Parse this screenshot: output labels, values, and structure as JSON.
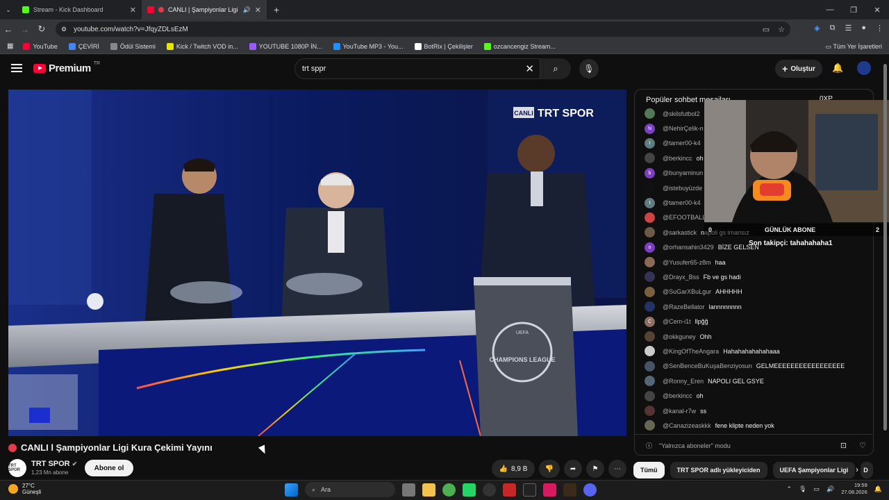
{
  "browser": {
    "tabs": [
      {
        "title": "Stream - Kick Dashboard",
        "color": "#53fc18",
        "active": false
      },
      {
        "title": "CANLI | Şampiyonlar Ligi",
        "color": "#ff0033",
        "active": true
      }
    ],
    "url": "youtube.com/watch?v=JfqyZDLsEzM",
    "bookmarks": [
      {
        "label": "YouTube",
        "color": "#ff0033"
      },
      {
        "label": "ÇEVİRİ",
        "color": "#4285f4"
      },
      {
        "label": "Ödül Sistemi",
        "color": "#aaaaaa"
      },
      {
        "label": "Kick / Twitch VOD in...",
        "color": "#e6e600"
      },
      {
        "label": "YOUTUBE 1080P İN...",
        "color": "#9b59ff"
      },
      {
        "label": "YouTube MP3 - You...",
        "color": "#1e90ff"
      },
      {
        "label": "BotRix | Çekilişler",
        "color": "#ffffff"
      },
      {
        "label": "ozcancengiz Stream...",
        "color": "#53fc18"
      }
    ],
    "bookmarks_all": "Tüm Yer İşaretleri"
  },
  "youtube": {
    "logo": "Premium",
    "logo_region": "TR",
    "search_value": "trt sppr",
    "create_label": "Oluştur"
  },
  "video": {
    "title": "CANLI l Şampiyonlar Ligi Kura Çekimi Yayını",
    "overlay_channel": "TRT SPOR",
    "overlay_badge": "CANLI",
    "podium_text": "CHAMPIONS LEAGUE",
    "podium_uefa": "UEFA"
  },
  "channel": {
    "name": "TRT SPOR",
    "avatar_text": "TRT SPOR",
    "subscribers": "1,23 Mn abone",
    "subscribe_label": "Abone ol",
    "likes": "8,9 B"
  },
  "chat": {
    "header": "Popüler sohbet mesajları",
    "footer": "\"Yalnızca aboneler\" modu",
    "messages": [
      {
        "user": "@skilsfutbol2",
        "text": "",
        "color": "#557755",
        "initial": ""
      },
      {
        "user": "@NehirÇelik-n",
        "text": "",
        "color": "#7b3fc4",
        "initial": "N"
      },
      {
        "user": "@tamer00-k4",
        "text": "",
        "color": "#5f7c80",
        "initial": "t"
      },
      {
        "user": "@berkincc",
        "text": "oh",
        "color": "#444444",
        "initial": ""
      },
      {
        "user": "@bunyaminun",
        "text": "",
        "color": "#7b3fc4",
        "initial": "b"
      },
      {
        "user": "@istebuyüzde",
        "text": "",
        "color": "#111111",
        "initial": ""
      },
      {
        "user": "@tamer00-k4",
        "text": "",
        "color": "#5f7c80",
        "initial": "t"
      },
      {
        "user": "@EFOOTBALL",
        "text": "",
        "color": "#c44",
        "initial": ""
      },
      {
        "user": "@sarkastick",
        "text": "napoli gs imansız",
        "color": "#6b5a45",
        "initial": ""
      },
      {
        "user": "@orhansahin3429",
        "text": "BİZE GELSEN",
        "color": "#7b3fc4",
        "initial": "o"
      },
      {
        "user": "@Yusufer65-z8m",
        "text": "haa",
        "color": "#8a6a55",
        "initial": ""
      },
      {
        "user": "@Drayx_Bss",
        "text": "Fb ve gs hadi",
        "color": "#333355",
        "initial": ""
      },
      {
        "user": "@SuGarXBuLgur",
        "text": "AHHHHH",
        "color": "#7a6040",
        "initial": ""
      },
      {
        "user": "@RazeBellator",
        "text": "lannnnnnnn",
        "color": "#223366",
        "initial": ""
      },
      {
        "user": "@Cem-i1t",
        "text": "llpğğ",
        "color": "#8d6e63",
        "initial": "C"
      },
      {
        "user": "@okkguney",
        "text": "Ohh",
        "color": "#554433",
        "initial": ""
      },
      {
        "user": "@KingOfTheAngara",
        "text": "Hahahahahahahaaa",
        "color": "#cccccc",
        "initial": ""
      },
      {
        "user": "@SenBenceBuKuşaBenziyosun",
        "text": "GELMEEEEEEEEEEEEEEEEE",
        "color": "#445566",
        "initial": ""
      },
      {
        "user": "@Ronny_Eren",
        "text": "NAPOLI GEL GSYE",
        "color": "#556677",
        "initial": ""
      },
      {
        "user": "@berkincc",
        "text": "oh",
        "color": "#444444",
        "initial": ""
      },
      {
        "user": "@kanal-r7w",
        "text": "ss",
        "color": "#553333",
        "initial": ""
      },
      {
        "user": "@Canazizeaskkk",
        "text": "fene klipte neden yok",
        "color": "#666655",
        "initial": ""
      }
    ]
  },
  "overlay": {
    "daily_sub_left": "0",
    "daily_sub_label": "GÜNLÜK ABONE",
    "daily_sub_right": "2",
    "last_follower": "Son takipçi: tahahahaha1",
    "badge_text": "0XP"
  },
  "chips": [
    "Tümü",
    "TRT SPOR adlı yükleyiciden",
    "UEFA Şampiyonlar Ligi",
    "D"
  ],
  "taskbar": {
    "temp": "27°C",
    "weather": "Güneşli",
    "search": "Ara",
    "time": "19:59",
    "date": "27.08.2026"
  }
}
